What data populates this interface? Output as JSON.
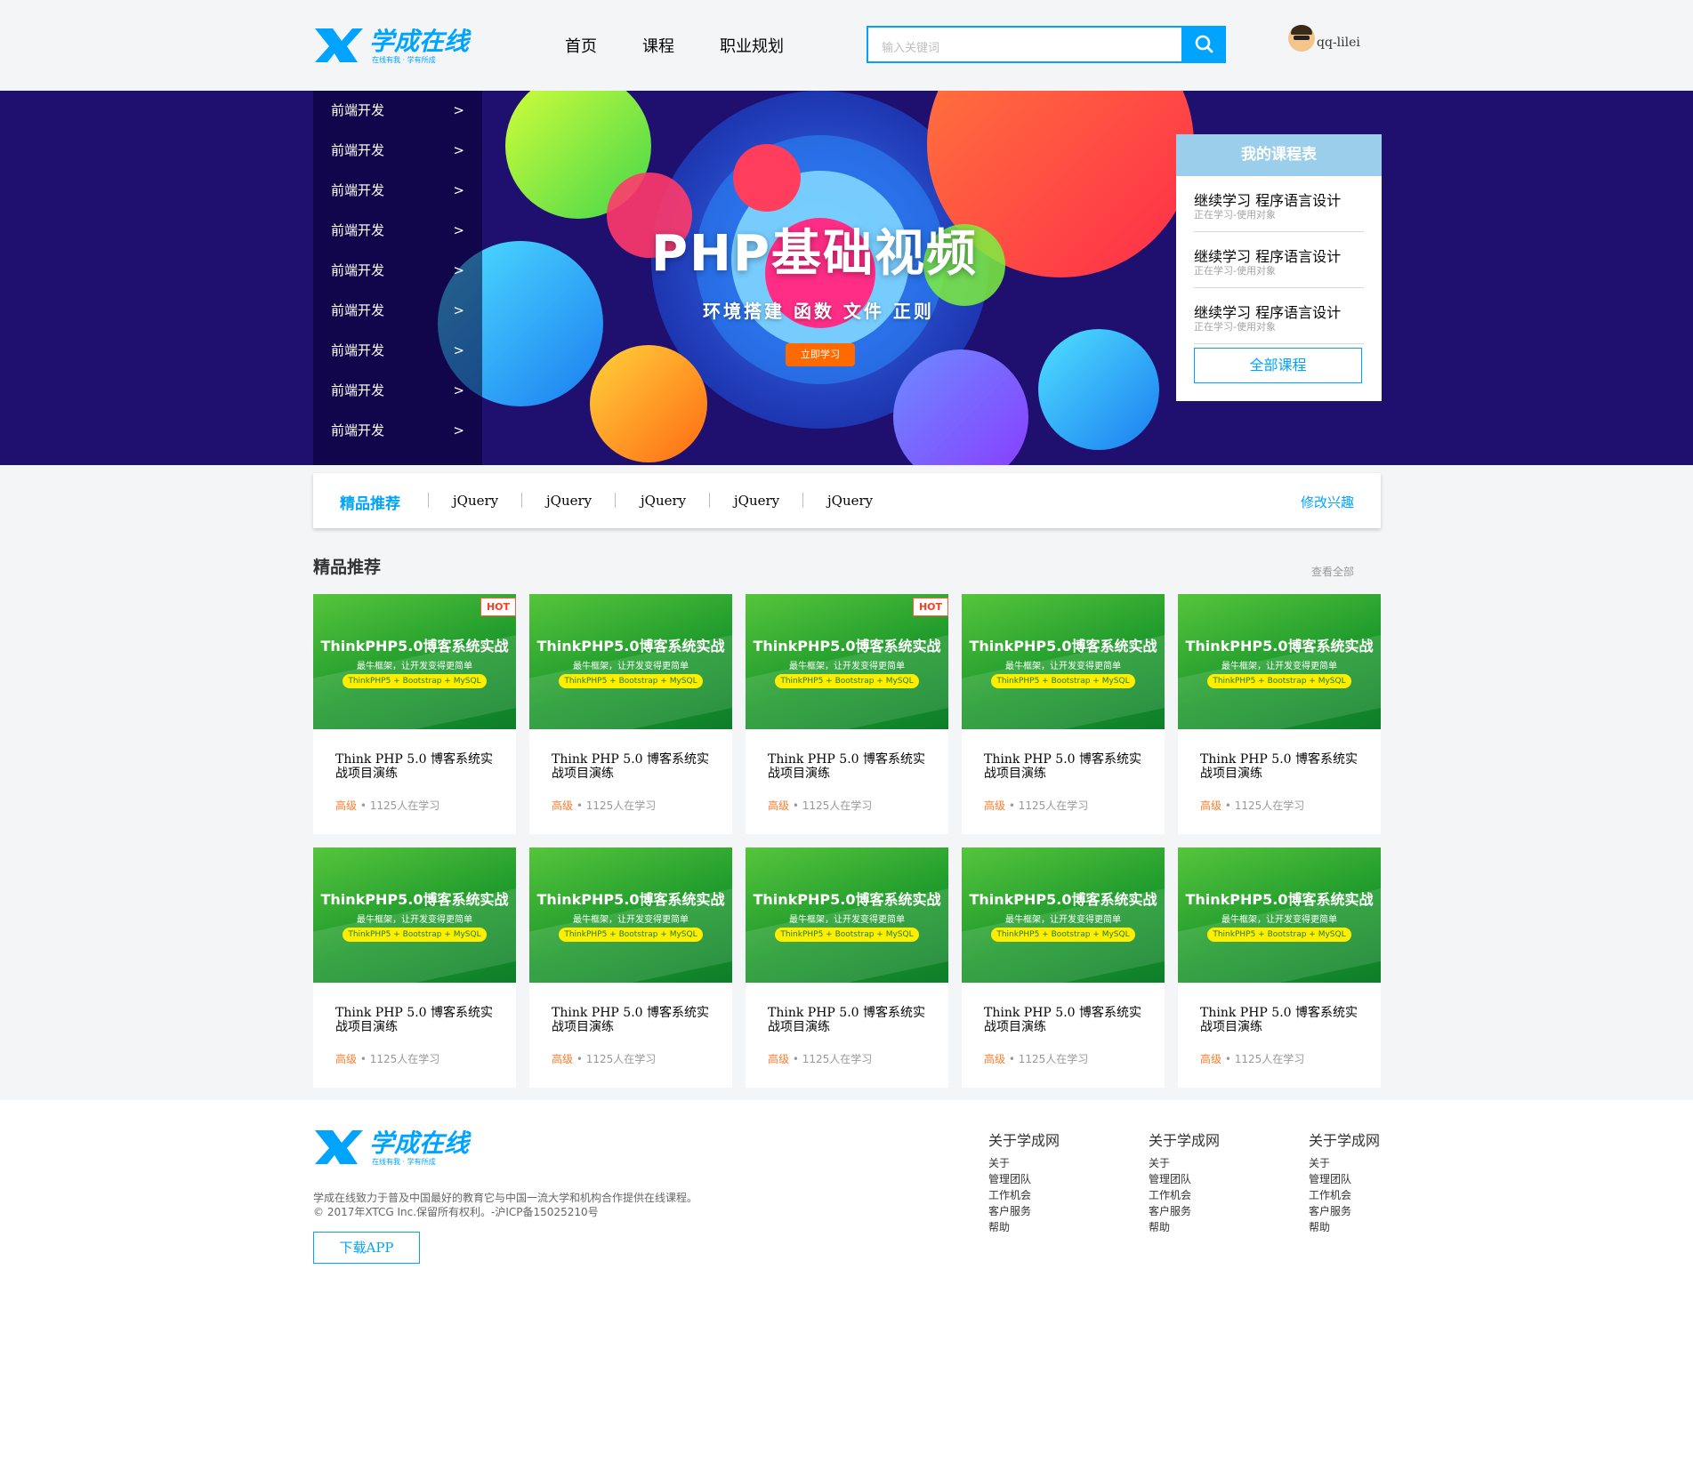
{
  "header": {
    "logo_text": "学成在线",
    "logo_slogan": "在线有我 · 学有所成",
    "nav": [
      "首页",
      "课程",
      "职业规划"
    ],
    "search_placeholder": "输入关键词",
    "username": "qq-lilei"
  },
  "banner": {
    "side_menu": [
      {
        "label": "前端开发",
        "arrow": ">"
      },
      {
        "label": "前端开发",
        "arrow": ">"
      },
      {
        "label": "前端开发",
        "arrow": ">"
      },
      {
        "label": "前端开发",
        "arrow": ">"
      },
      {
        "label": "前端开发",
        "arrow": ">"
      },
      {
        "label": "前端开发",
        "arrow": ">"
      },
      {
        "label": "前端开发",
        "arrow": ">"
      },
      {
        "label": "前端开发",
        "arrow": ">"
      },
      {
        "label": "前端开发",
        "arrow": ">"
      }
    ],
    "title": "PHP基础视频",
    "subtitle": "环境搭建  函数  文件  正则",
    "cta": "立即学习"
  },
  "schedule": {
    "title": "我的课程表",
    "items": [
      {
        "title": "继续学习 程序语言设计",
        "sub": "正在学习-使用对象"
      },
      {
        "title": "继续学习 程序语言设计",
        "sub": "正在学习-使用对象"
      },
      {
        "title": "继续学习 程序语言设计",
        "sub": "正在学习-使用对象"
      }
    ],
    "all_button": "全部课程"
  },
  "tagbar": {
    "first": "精品推荐",
    "tags": [
      "jQuery",
      "jQuery",
      "jQuery",
      "jQuery",
      "jQuery"
    ],
    "edit": "修改兴趣"
  },
  "section": {
    "title": "精品推荐",
    "view_all": "查看全部"
  },
  "course_thumb": {
    "title": "ThinkPHP5.0博客系统实战",
    "subtitle": "最牛框架，让开发变得更简单",
    "pill": "ThinkPHP5 + Bootstrap + MySQL"
  },
  "courses": [
    {
      "name": "Think PHP 5.0 博客系统实战项目演练",
      "level": "高级",
      "students": "• 1125人在学习",
      "hot": "HOT"
    },
    {
      "name": "Think PHP 5.0 博客系统实战项目演练",
      "level": "高级",
      "students": "• 1125人在学习",
      "hot": ""
    },
    {
      "name": "Think PHP 5.0 博客系统实战项目演练",
      "level": "高级",
      "students": "• 1125人在学习",
      "hot": "HOT"
    },
    {
      "name": "Think PHP 5.0 博客系统实战项目演练",
      "level": "高级",
      "students": "• 1125人在学习",
      "hot": ""
    },
    {
      "name": "Think PHP 5.0 博客系统实战项目演练",
      "level": "高级",
      "students": "• 1125人在学习",
      "hot": ""
    },
    {
      "name": "Think PHP 5.0 博客系统实战项目演练",
      "level": "高级",
      "students": "• 1125人在学习",
      "hot": ""
    },
    {
      "name": "Think PHP 5.0 博客系统实战项目演练",
      "level": "高级",
      "students": "• 1125人在学习",
      "hot": ""
    },
    {
      "name": "Think PHP 5.0 博客系统实战项目演练",
      "level": "高级",
      "students": "• 1125人在学习",
      "hot": ""
    },
    {
      "name": "Think PHP 5.0 博客系统实战项目演练",
      "level": "高级",
      "students": "• 1125人在学习",
      "hot": ""
    },
    {
      "name": "Think PHP 5.0 博客系统实战项目演练",
      "level": "高级",
      "students": "• 1125人在学习",
      "hot": ""
    }
  ],
  "footer": {
    "desc_line1": "学成在线致力于普及中国最好的教育它与中国一流大学和机构合作提供在线课程。",
    "desc_line2": "© 2017年XTCG Inc.保留所有权利。-沪ICP备15025210号",
    "app_button": "下载APP",
    "columns": [
      {
        "heading": "关于学成网",
        "links": [
          "关于",
          "管理团队",
          "工作机会",
          "客户服务",
          "帮助"
        ]
      },
      {
        "heading": "关于学成网",
        "links": [
          "关于",
          "管理团队",
          "工作机会",
          "客户服务",
          "帮助"
        ]
      },
      {
        "heading": "关于学成网",
        "links": [
          "关于",
          "管理团队",
          "工作机会",
          "客户服务",
          "帮助"
        ]
      }
    ]
  },
  "colors": {
    "brand_blue": "#00a4ff",
    "banner_bg": "#1f0f6e",
    "level_orange": "#ff7c2d",
    "hot_red": "#ff3b1f"
  }
}
